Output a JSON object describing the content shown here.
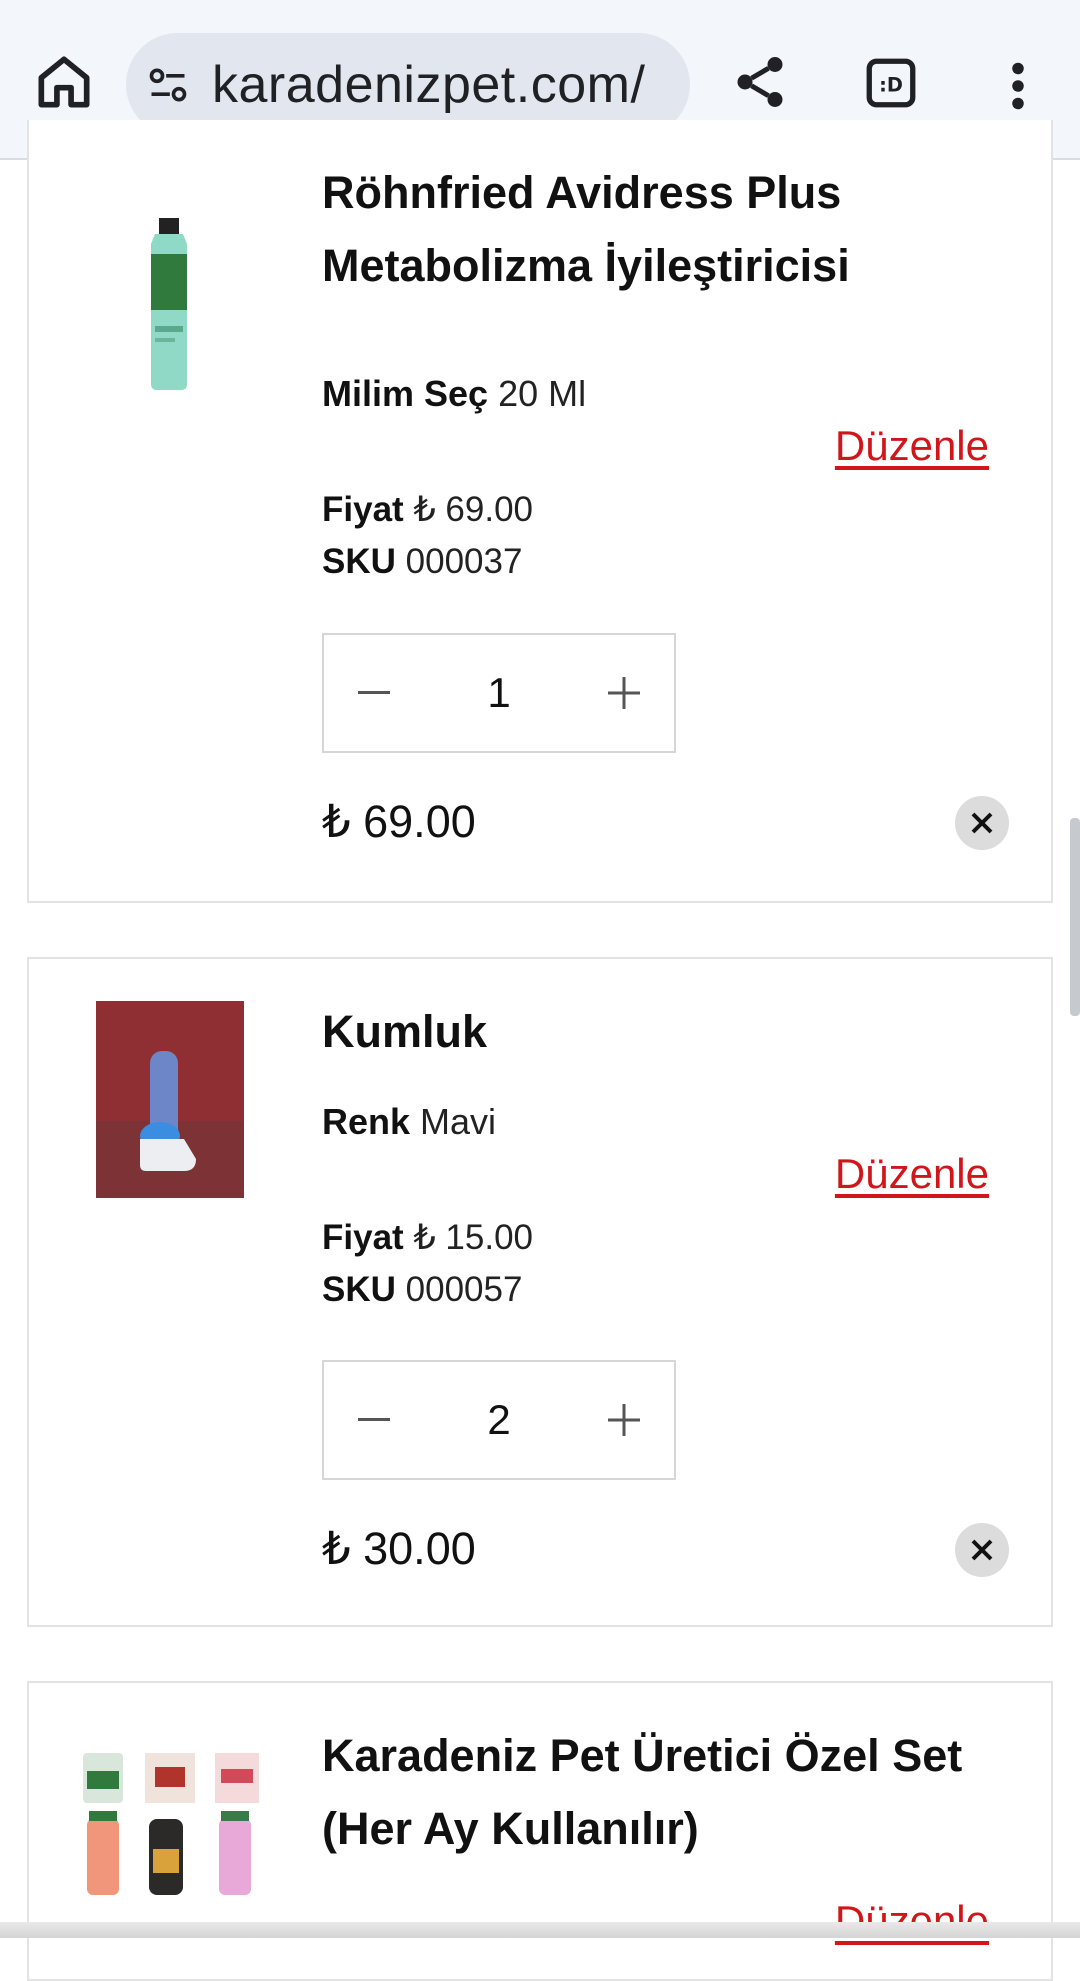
{
  "browser": {
    "url": "karadenizpet.com/",
    "icons": [
      "home-icon",
      "site-settings-icon",
      "share-icon",
      "tab-switcher-icon",
      "more-vert-icon"
    ]
  },
  "cart": {
    "items": [
      {
        "title_lines": [
          "Röhnfried Avidress Plus",
          "Metabolizma İyileştiricisi"
        ],
        "attr_label": "Milim Seç",
        "attr_value": "20 Ml",
        "edit_label": "Düzenle",
        "price_label": "Fiyat",
        "price_value": "₺ 69.00",
        "sku_label": "SKU",
        "sku_value": "000037",
        "quantity": "1",
        "line_total": "₺ 69.00"
      },
      {
        "title_lines": [
          "Kumluk"
        ],
        "attr_label": "Renk",
        "attr_value": "Mavi",
        "edit_label": "Düzenle",
        "price_label": "Fiyat",
        "price_value": "₺ 15.00",
        "sku_label": "SKU",
        "sku_value": "000057",
        "quantity": "2",
        "line_total": "₺ 30.00"
      },
      {
        "title_lines": [
          "Karadeniz Pet Üretici Özel Set",
          "(Her Ay Kullanılır)"
        ],
        "edit_label": "Düzenle"
      }
    ]
  },
  "colors": {
    "accent_red": "#d0161b",
    "browser_bar": "#f3f6fb",
    "url_pill": "#e2e7ef"
  }
}
